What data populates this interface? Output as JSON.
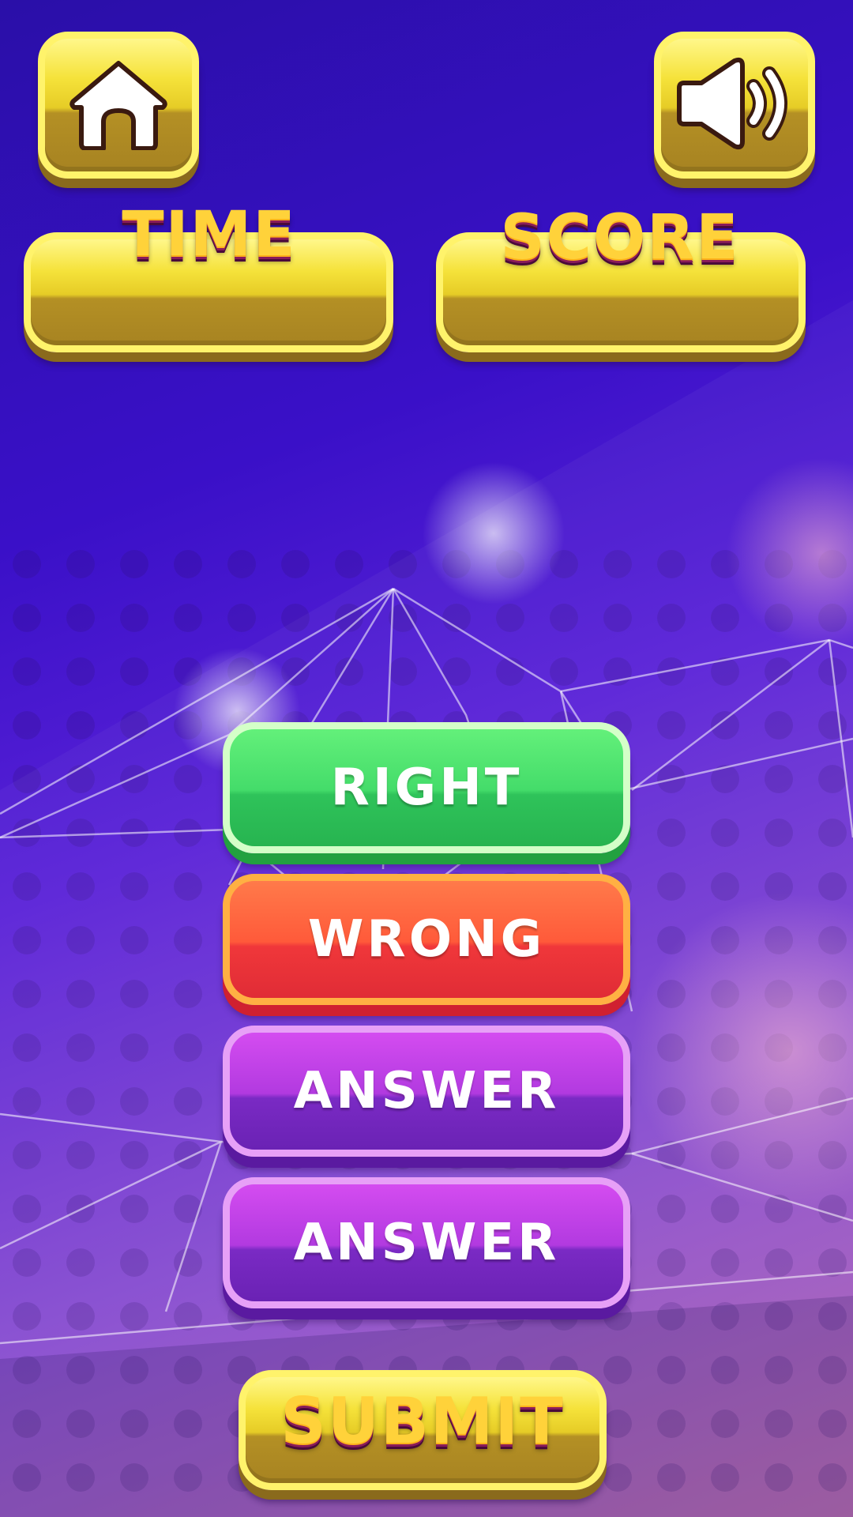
{
  "header": {
    "home_icon": "home-icon",
    "sound_icon": "speaker-volume-icon"
  },
  "stats": {
    "time_label": "TIME",
    "score_label": "SCORE",
    "time_value": "",
    "score_value": ""
  },
  "answers": [
    {
      "label": "RIGHT",
      "state": "correct",
      "color": "#44dc6a"
    },
    {
      "label": "WRONG",
      "state": "incorrect",
      "color": "#ff5a3a"
    },
    {
      "label": "ANSWER",
      "state": "neutral",
      "color": "#b23ae0"
    },
    {
      "label": "ANSWER",
      "state": "neutral",
      "color": "#b23ae0"
    }
  ],
  "submit_label": "SUBMIT",
  "colors": {
    "background_top": "#2a0fa8",
    "background_bottom": "#b86ab0",
    "gold_button": "#f5e23a",
    "gold_text": "#ffd23a"
  }
}
